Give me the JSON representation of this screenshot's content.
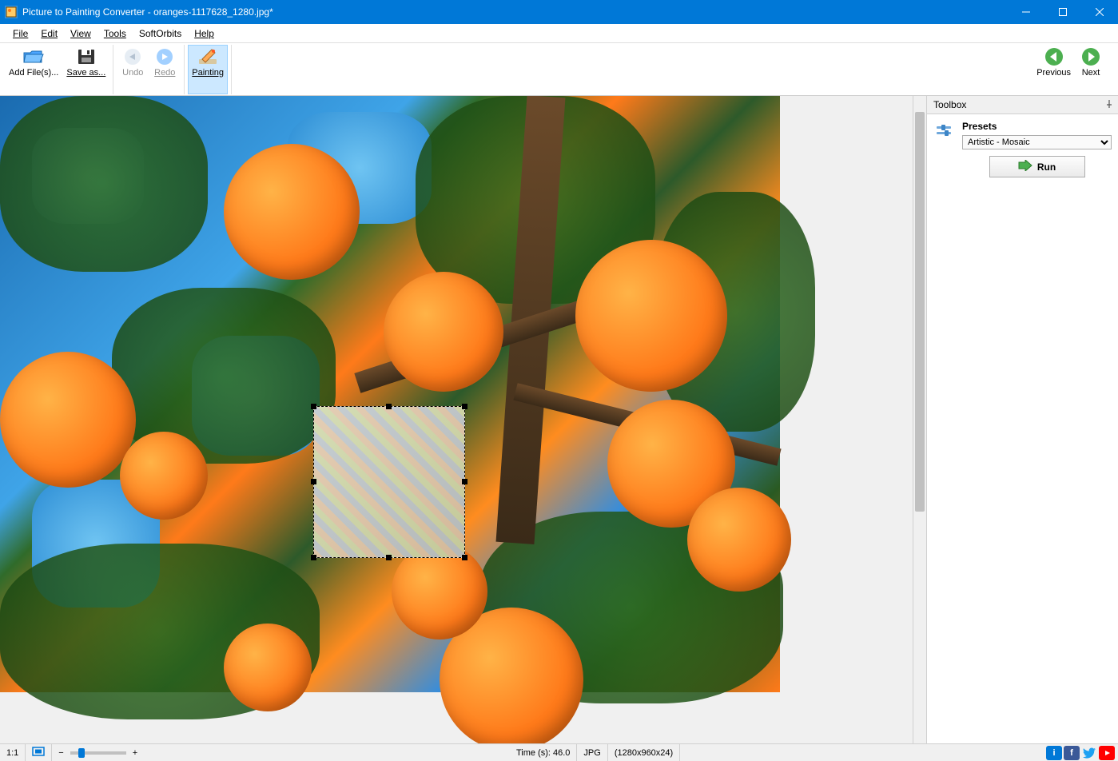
{
  "titlebar": {
    "app_title": "Picture to Painting Converter - oranges-1117628_1280.jpg*"
  },
  "menu": {
    "items": [
      "File",
      "Edit",
      "View",
      "Tools",
      "SoftOrbits",
      "Help"
    ]
  },
  "toolbar": {
    "add_files": "Add File(s)...",
    "save_as": "Save as...",
    "undo": "Undo",
    "redo": "Redo",
    "painting": "Painting",
    "previous": "Previous",
    "next": "Next"
  },
  "toolbox": {
    "title": "Toolbox",
    "presets_label": "Presets",
    "preset_selected": "Artistic - Mosaic",
    "run_label": "Run"
  },
  "statusbar": {
    "zoom_ratio": "1:1",
    "time_label": "Time (s): 46.0",
    "format": "JPG",
    "dimensions": "(1280x960x24)"
  }
}
